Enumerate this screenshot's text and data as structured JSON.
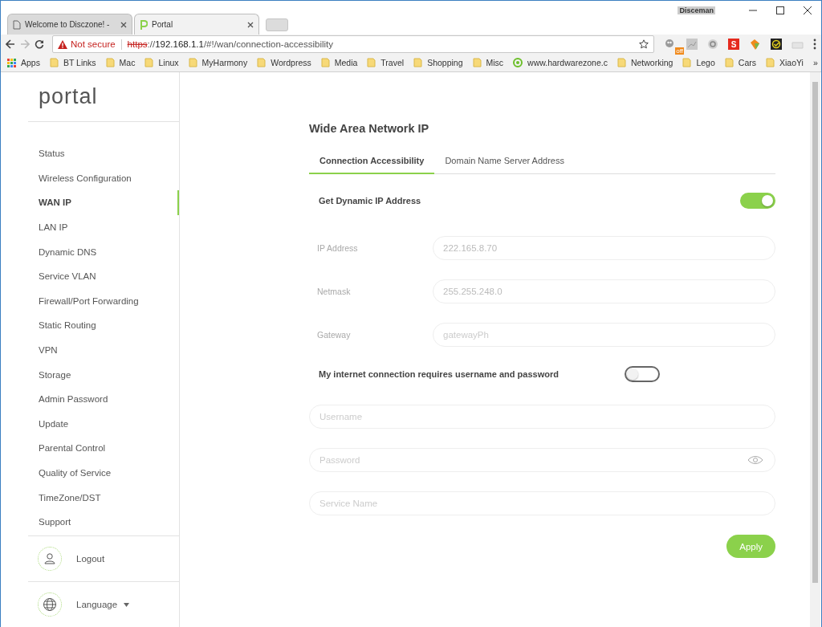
{
  "browser": {
    "tabs": [
      {
        "title": "Welcome to Disczone! - ",
        "kind": "page",
        "selected": false
      },
      {
        "title": "Portal",
        "kind": "portal",
        "selected": true
      }
    ],
    "profile": "Disceman",
    "security": "Not secure",
    "url": {
      "scheme": "https",
      "sep": "://",
      "host": "192.168.1.1",
      "path": "/#!/wan/connection-accessibility"
    },
    "extensions": [
      {
        "kind": "robot",
        "badge": "off"
      },
      {
        "kind": "chart"
      },
      {
        "kind": "ring"
      },
      {
        "kind": "s-logo",
        "text": "S"
      },
      {
        "kind": "leaf"
      },
      {
        "kind": "check"
      },
      {
        "kind": "tray"
      }
    ],
    "bookmarks": [
      {
        "label": "Apps",
        "kind": "apps"
      },
      {
        "label": "BT Links",
        "kind": "folder"
      },
      {
        "label": "Mac",
        "kind": "folder"
      },
      {
        "label": "Linux",
        "kind": "folder"
      },
      {
        "label": "MyHarmony",
        "kind": "folder"
      },
      {
        "label": "Wordpress",
        "kind": "folder"
      },
      {
        "label": "Media",
        "kind": "folder"
      },
      {
        "label": "Travel",
        "kind": "folder"
      },
      {
        "label": "Shopping",
        "kind": "folder"
      },
      {
        "label": "Misc",
        "kind": "folder"
      },
      {
        "label": "www.hardwarezone.c",
        "kind": "site"
      },
      {
        "label": "Networking",
        "kind": "folder"
      },
      {
        "label": "Lego",
        "kind": "folder"
      },
      {
        "label": "Cars",
        "kind": "folder"
      },
      {
        "label": "XiaoYi",
        "kind": "folder"
      }
    ],
    "bookmarks_overflow": "»"
  },
  "sidebar": {
    "logo": "portal",
    "items": [
      {
        "label": "Status",
        "selected": false
      },
      {
        "label": "Wireless Configuration",
        "selected": false
      },
      {
        "label": "WAN IP",
        "selected": true
      },
      {
        "label": "LAN IP",
        "selected": false
      },
      {
        "label": "Dynamic DNS",
        "selected": false
      },
      {
        "label": "Service VLAN",
        "selected": false
      },
      {
        "label": "Firewall/Port Forwarding",
        "selected": false
      },
      {
        "label": "Static Routing",
        "selected": false
      },
      {
        "label": "VPN",
        "selected": false
      },
      {
        "label": "Storage",
        "selected": false
      },
      {
        "label": "Admin Password",
        "selected": false
      },
      {
        "label": "Update",
        "selected": false
      },
      {
        "label": "Parental Control",
        "selected": false
      },
      {
        "label": "Quality of Service",
        "selected": false
      },
      {
        "label": "TimeZone/DST",
        "selected": false
      },
      {
        "label": "Support",
        "selected": false
      }
    ],
    "footer": [
      {
        "label": "Logout",
        "kind": "user"
      },
      {
        "label": "Language",
        "kind": "globe"
      }
    ]
  },
  "main": {
    "title": "Wide Area Network IP",
    "tabs": [
      {
        "label": "Connection Accessibility",
        "selected": true
      },
      {
        "label": "Domain Name Server Address",
        "selected": false
      }
    ],
    "dynamic_ip": {
      "label": "Get Dynamic IP Address",
      "on": true
    },
    "static_fields": [
      {
        "label": "IP Address",
        "value": "222.165.8.70",
        "disabled": true
      },
      {
        "label": "Netmask",
        "value": "255.255.248.0",
        "disabled": true
      },
      {
        "label": "Gateway",
        "placeholder": "gatewayPh",
        "disabled": true
      }
    ],
    "auth": {
      "label": "My internet connection requires username and password",
      "on": false
    },
    "auth_fields": [
      {
        "placeholder": "Username",
        "kind": "text"
      },
      {
        "placeholder": "Password",
        "kind": "password"
      },
      {
        "placeholder": "Service Name",
        "kind": "text"
      }
    ],
    "apply": "Apply"
  }
}
